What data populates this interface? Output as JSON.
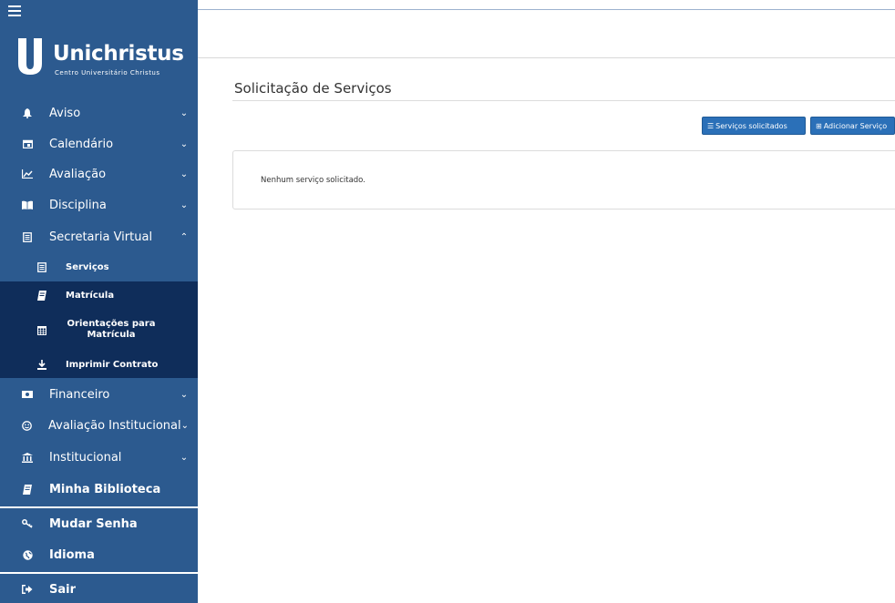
{
  "brand": {
    "name": "Unichristus",
    "subtitle": "Centro Universitário Christus"
  },
  "sidebar": {
    "items": [
      {
        "label": "Aviso",
        "icon": "bell-icon"
      },
      {
        "label": "Calendário",
        "icon": "calendar-icon"
      },
      {
        "label": "Avaliação",
        "icon": "line-chart-icon"
      },
      {
        "label": "Disciplina",
        "icon": "book-open-icon"
      },
      {
        "label": "Secretaria Virtual",
        "icon": "document-icon"
      }
    ],
    "submenu": [
      {
        "label": "Serviços",
        "icon": "document-icon"
      },
      {
        "label": "Matrícula",
        "icon": "book-icon"
      },
      {
        "label": "Orientações para Matrícula",
        "icon": "calendar-grid-icon"
      },
      {
        "label": "Imprimir Contrato",
        "icon": "download-icon"
      }
    ],
    "items2": [
      {
        "label": "Financeiro",
        "icon": "money-icon"
      },
      {
        "label": "Avaliação Institucional",
        "icon": "smile-icon"
      },
      {
        "label": "Institucional",
        "icon": "institution-icon"
      },
      {
        "label": "Minha Biblioteca",
        "icon": "book-icon"
      }
    ],
    "account": [
      {
        "label": "Mudar Senha",
        "icon": "key-icon"
      },
      {
        "label": "Idioma",
        "icon": "globe-icon"
      },
      {
        "label": "Sair",
        "icon": "sign-out-icon"
      }
    ]
  },
  "main": {
    "title": "Solicitação de Serviços",
    "btn_requested": "Serviços solicitados",
    "btn_add": "Adicionar Serviço",
    "empty_message": "Nenhum serviço solicitado."
  },
  "colors": {
    "sidebar": "#2c5a8f",
    "submenu": "#0f2d5a",
    "button": "#2b70b8"
  }
}
